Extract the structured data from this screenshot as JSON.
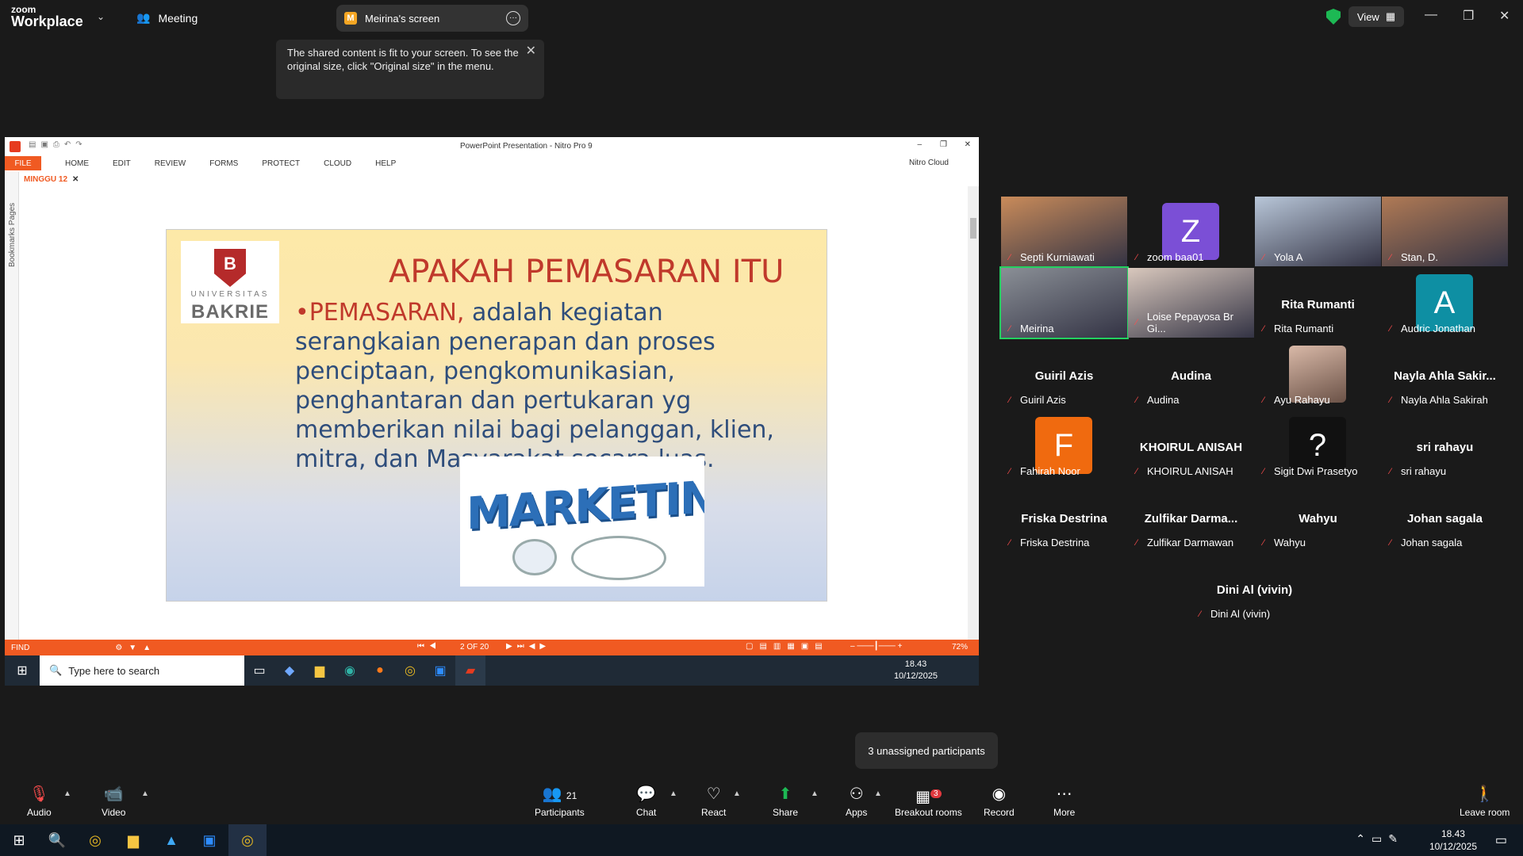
{
  "topbar": {
    "logo_small": "zoom",
    "logo_big": "Workplace",
    "meeting_label": "Meeting",
    "share_tab_initial": "M",
    "share_tab_label": "Meirina's screen",
    "view_label": "View"
  },
  "tooltip": {
    "text": "The shared content is fit to your screen. To see the original size, click \"Original size\" in the menu."
  },
  "nitro": {
    "window_title": "PowerPoint Presentation - Nitro Pro 9",
    "menu": [
      "FILE",
      "HOME",
      "EDIT",
      "REVIEW",
      "FORMS",
      "PROTECT",
      "CLOUD",
      "HELP"
    ],
    "cloud_label": "Nitro Cloud",
    "doc_tab": "MINGGU 12",
    "sidebar_label": "Bookmarks  Pages",
    "status_find": "FIND",
    "page_indicator": "2 OF 20",
    "zoom": "72%"
  },
  "slide": {
    "logo_line1": "B",
    "logo_line2": "UNIVERSITAS",
    "logo_line3": "BAKRIE",
    "title": "APAKAH PEMASARAN ITU",
    "bullet_red": "PEMASARAN,",
    "bullet_text": " adalah kegiatan serangkaian penerapan dan proses penciptaan, pengkomunikasian, penghantaran dan pertukaran yg memberikan nilai bagi pelanggan, klien, mitra, dan Masyarakat secara luas.",
    "image_word": "MARKETING"
  },
  "inner_taskbar": {
    "search_placeholder": "Type here to search",
    "time": "18.43",
    "date": "10/12/2025"
  },
  "participants": [
    {
      "name": "Septi Kurniawati",
      "kind": "photo",
      "color": "#c98b5a"
    },
    {
      "name": "zoom baa01",
      "kind": "avatar",
      "letter": "Z",
      "color": "#7b4fd6"
    },
    {
      "name": "Yola A",
      "kind": "photo",
      "color": "#b8c6d8"
    },
    {
      "name": "Stan, D.",
      "kind": "photo",
      "color": "#b07a55"
    },
    {
      "name": "Meirina",
      "kind": "photo",
      "color": "#8a8f96",
      "active": true
    },
    {
      "name": "Loise Pepayosa Br Gi...",
      "kind": "photo",
      "color": "#d9c8bd"
    },
    {
      "name": "Rita Rumanti",
      "kind": "text",
      "big": "Rita Rumanti"
    },
    {
      "name": "Audric Jonathan",
      "kind": "avatar",
      "letter": "A",
      "color": "#0e8fa3"
    },
    {
      "name": "Guiril Azis",
      "kind": "text",
      "big": "Guiril Azis"
    },
    {
      "name": "Audina",
      "kind": "text",
      "big": "Audina"
    },
    {
      "name": "Ayu Rahayu",
      "kind": "photo-small",
      "color": "#6b5247"
    },
    {
      "name": "Nayla Ahla Sakirah",
      "kind": "text",
      "big": "Nayla Ahla Sakir..."
    },
    {
      "name": "Fahirah Noor",
      "kind": "avatar",
      "letter": "F",
      "color": "#f06a0f"
    },
    {
      "name": "KHOIRUL ANISAH",
      "kind": "text",
      "big": "KHOIRUL ANISAH"
    },
    {
      "name": "Sigit Dwi Prasetyo",
      "kind": "avatar",
      "letter": "?",
      "color": "#111111"
    },
    {
      "name": "sri rahayu",
      "kind": "text",
      "big": "sri rahayu"
    },
    {
      "name": "Friska Destrina",
      "kind": "text",
      "big": "Friska Destrina"
    },
    {
      "name": "Zulfikar Darmawan",
      "kind": "text",
      "big": "Zulfikar  Darma..."
    },
    {
      "name": "Wahyu",
      "kind": "text",
      "big": "Wahyu"
    },
    {
      "name": "Johan sagala",
      "kind": "text",
      "big": "Johan sagala"
    },
    {
      "name": "Dini Al (vivin)",
      "kind": "text",
      "big": "Dini Al (vivin)"
    }
  ],
  "unassigned": "3 unassigned participants",
  "toolbar": {
    "audio": "Audio",
    "video": "Video",
    "participants": "Participants",
    "participants_count": "21",
    "chat": "Chat",
    "react": "React",
    "share": "Share",
    "apps": "Apps",
    "breakout": "Breakout rooms",
    "breakout_badge": "3",
    "record": "Record",
    "more": "More",
    "leave": "Leave room"
  },
  "taskbar": {
    "time": "18.43",
    "date": "10/12/2025"
  }
}
